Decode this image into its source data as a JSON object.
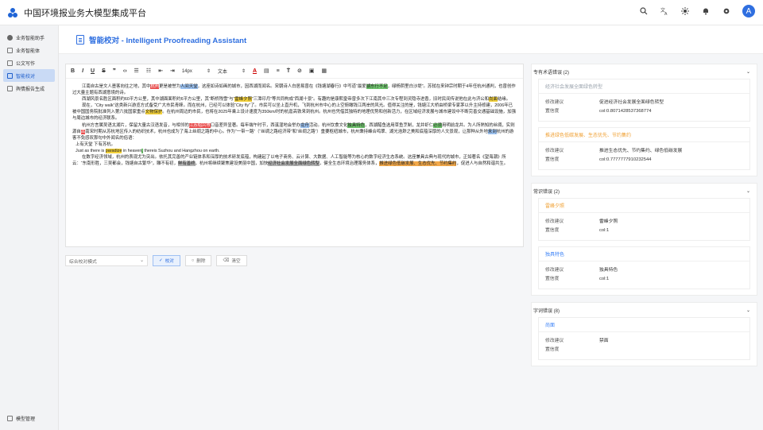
{
  "app": {
    "title": "中国环境报业务大模型集成平台",
    "avatar_letter": "A"
  },
  "topbar_icons": [
    "search-icon",
    "translate-icon",
    "sun-icon",
    "notification-icon",
    "settings-icon"
  ],
  "sidebar": {
    "items": [
      {
        "label": "业务智能助手",
        "icon": "chat-icon"
      },
      {
        "label": "业务智能体",
        "icon": "grid-icon"
      },
      {
        "label": "公文写作",
        "icon": "grid-icon"
      },
      {
        "label": "智能校对",
        "icon": "grid-icon",
        "active": true
      },
      {
        "label": "舆情报告生成",
        "icon": "grid-icon"
      }
    ],
    "bottom_label": "模型管理"
  },
  "page": {
    "title": "智能校对 - Intelligent Proofreading Assistant"
  },
  "toolbar": {
    "font_size": "14px",
    "font_type": "文本"
  },
  "editor": {
    "paragraphs": [
      [
        {
          "t": "江南自古是文人墨客向往之地，其中"
        },
        {
          "t": "杭州",
          "h": "hr"
        },
        {
          "t": "更是被誉为"
        },
        {
          "t": "人间天堂",
          "h": "hb"
        },
        {
          "t": "，这座如诗如画的城市，因西湖而闻名。宋朝诗人白居易曾在《钱塘湖春行》中写道“最爱"
        },
        {
          "t": "湖东行不足",
          "h": "hg"
        },
        {
          "t": "，绿杨阴里白沙堤”。苏轼在来钟宗时期于4年任杭州通判，也曾创作过大量主题有西湖意境的诗。"
        }
      ],
      [
        {
          "t": "西湖风景名胜区面积约60平方公里，其中湖面面积约6平方公里，其”断桥残雪”与“"
        },
        {
          "t": "雷峰夕照",
          "h": "hy"
        },
        {
          "t": "”三潭印月”等共同构成“西湖十景”。有趣的是康熙皇帝曾多次下江南其中三次专程到灵隐寺进香，旧时民间传说他在此与济公和"
        },
        {
          "t": "尚面",
          "h": "hy"
        },
        {
          "t": "结缘。"
        }
      ],
      [
        {
          "t": "现在，“City walk”这类新兴游览方式备受广大市民青睐。而在杭州，已经可以体验“City fly”了。市民可以坐上直升机，飞到杭州市中心的上空俯瞰钱江两岸的风光。值得关注的是，钱塘江大桥由桥梁专家茅以升主持修建，2006年已被中国国务院批准列入第六批国家重点"
        },
        {
          "t": "文物保护",
          "h": "hy"
        },
        {
          "t": "。在杭州周边的市民，也将在2025年乘上设计速度为350km/时的杭嘉高铁来到杭州。杭州也凭借其独特的地理优势和创新活力，在区域经济发展与城市建设中不断完善交通基础设施，加强与周边城市的经济联系。"
        }
      ],
      [
        {
          "t": "杭州方言属吴语太湖片，保留大量古汉语发音，与相邻的"
        },
        {
          "t": "江苏绍兴市",
          "h": "hr"
        },
        {
          "t": "口音差异显著。每年端午时节，西溪湿地会举办"
        },
        {
          "t": "龙舟",
          "h": "hb"
        },
        {
          "t": "活动。杭州饮食文化"
        },
        {
          "t": "独具特色",
          "h": "hg"
        },
        {
          "t": "，西湖醋鱼选用草鱼烹制，龙井虾仁"
        },
        {
          "t": "必须",
          "h": "hg"
        },
        {
          "t": "用明前龙井。为人所熟知的丝绸，实则源自"
        },
        {
          "t": "古",
          "h": "hr"
        },
        {
          "t": "南宋时期从苏杭地区传入的纺织技术，杭州也成为了海上丝绸之路的中心。作为“一带一路”（“丝绸之路经济带”和“丝绸之路”）重要枢纽城市，杭州秉持峰合鸣翠、湖光浩渺之美和底蕴深厚的人文景观，让那种从外地"
        },
        {
          "t": "来到",
          "h": "hb"
        },
        {
          "t": "杭州的游客不免感叹那句中外闻名的俗语："
        }
      ],
      [
        {
          "t": "上有天堂 下有苏杭。"
        }
      ],
      [
        {
          "t": "Just as there is "
        },
        {
          "t": "paradize",
          "h": "hy"
        },
        {
          "t": " in heaven"
        },
        {
          "t": ",",
          "h": "hg"
        },
        {
          "t": " thereis Suzhou and Hangzhou on earth."
        }
      ],
      [
        {
          "t": "在数字经济领域，杭州的表现尤为突出。依托其完善的产业链体系和深厚的技术研发底蕴，构建起了以电子商务、云计算、大数据、人工智能等为核心的数字经济生态系统。这座兼具古典与现代的城市，正如著名《望海潮》所云：“东南形胜，三吴都会，钱塘自古繁华”，雕不有初，"
        },
        {
          "t": "鲜有善终",
          "h": "hd"
        },
        {
          "t": "，杭州将继续聚焦建设美丽中国，加快"
        },
        {
          "t": "经济社会发展全面绿色转型",
          "h": "hd"
        },
        {
          "t": "，健全生态环境治理服务体系，"
        },
        {
          "t": "推进绿色低碳发展、生态优先、节约集约",
          "h": "ho"
        },
        {
          "t": "，促进人与自然和谐共生。"
        }
      ]
    ]
  },
  "modebar": {
    "mode": "综合校对模式",
    "proofread": "校对",
    "clear_marks": "删除",
    "clear": "清空"
  },
  "errors": {
    "groups": [
      {
        "title": "专有术语错误 (2)",
        "cards": [
          {
            "word": "经济社会发展全面绿色转型",
            "word_color": "#9aa3ad",
            "suggestion": "促进经济社会发展全面绿色转型",
            "confidence": "col:0.8071428537368774"
          },
          {
            "word": "推进绿色低碳发展、生态优先、节约集约",
            "word_color": "#f0a033",
            "suggestion": "推进生态优先、节约集约、绿色低碳发展",
            "confidence": "col:0.7777777910232544"
          }
        ]
      },
      {
        "title": "常识错误 (2)",
        "cards": [
          {
            "word": "雷峰夕照",
            "word_color": "#f0a033",
            "suggestion": "雷峰夕照",
            "confidence": "col:1"
          },
          {
            "word": "独具特色",
            "word_color": "#3b82f6",
            "suggestion": "独具特色",
            "confidence": "col:1"
          }
        ]
      },
      {
        "title": "字词错误 (8)",
        "cards": [
          {
            "word": "尚面",
            "word_color": "#3b82f6",
            "suggestion": "禁面",
            "confidence": ""
          }
        ]
      }
    ],
    "suggestion_label": "修改建议",
    "confidence_label": "置信度"
  }
}
